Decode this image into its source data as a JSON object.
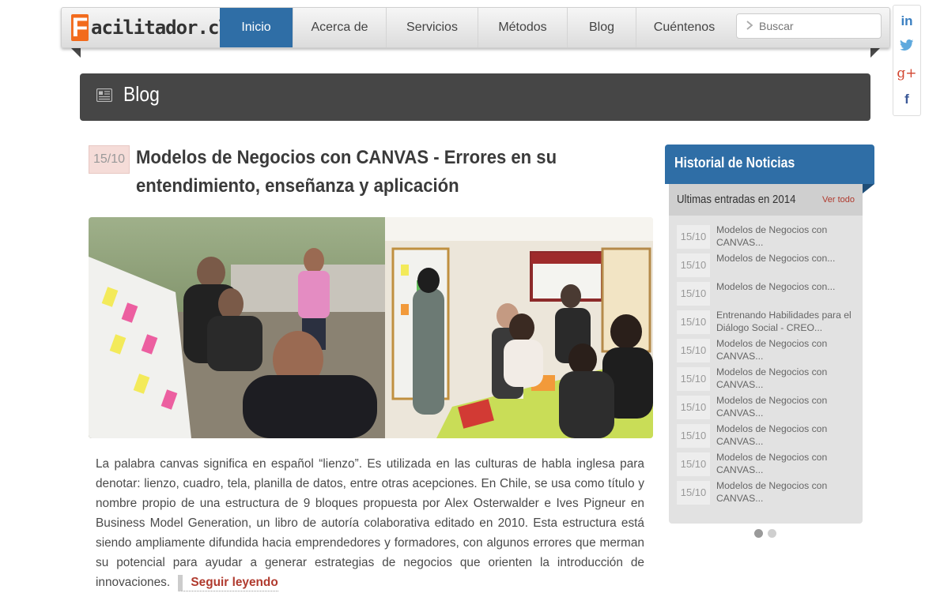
{
  "brand": {
    "letter": "F",
    "rest": "acilitador.cl"
  },
  "nav": {
    "items": [
      {
        "label": "Inicio",
        "active": true
      },
      {
        "label": "Acerca de",
        "active": false
      },
      {
        "label": "Servicios",
        "active": false
      },
      {
        "label": "Métodos",
        "active": false
      },
      {
        "label": "Blog",
        "active": false
      },
      {
        "label": "Cuéntenos",
        "active": false
      }
    ],
    "search_placeholder": "Buscar"
  },
  "social": {
    "linkedin": "in",
    "twitter": "twitter-bird-icon",
    "googleplus": "g+",
    "facebook": "f"
  },
  "page": {
    "section_title": "Blog"
  },
  "article": {
    "date": "15/10",
    "title": "Modelos de Negocios con CANVAS - Errores en su entendimiento, enseñanza y aplicación",
    "body": "La palabra canvas significa en español “lienzo”. Es utilizada en las culturas de habla inglesa para denotar: lienzo, cuadro, tela, planilla de datos, entre otras acepciones. En Chile, se usa como título y nombre propio de una estructura de 9 bloques propuesta por Alex Osterwalder e Ives Pigneur en Business Model Generation, un libro de autoría colaborativa editado en 2010. Esta estructura está siendo ampliamente difundida hacia emprendedores y formadores, con algunos errores que merman su potencial para ayudar a generar estrategias de negocios que orienten la introducción de innovaciones.",
    "read_more": "Seguir leyendo"
  },
  "sidebar": {
    "title": "Historial de Noticias",
    "subtitle": "Ultimas entradas en 2014",
    "see_all": "Ver todo",
    "entries": [
      {
        "date": "15/10",
        "text": "Modelos de Negocios con CANVAS..."
      },
      {
        "date": "15/10",
        "text": "Modelos de Negocios con..."
      },
      {
        "date": "15/10",
        "text": "Modelos de Negocios con..."
      },
      {
        "date": "15/10",
        "text": "Entrenando Habilidades para el Diálogo Social - CREO..."
      },
      {
        "date": "15/10",
        "text": "Modelos de Negocios con CANVAS..."
      },
      {
        "date": "15/10",
        "text": "Modelos de Negocios con CANVAS..."
      },
      {
        "date": "15/10",
        "text": "Modelos de Negocios con CANVAS..."
      },
      {
        "date": "15/10",
        "text": "Modelos de Negocios con CANVAS..."
      },
      {
        "date": "15/10",
        "text": "Modelos de Negocios con CANVAS..."
      },
      {
        "date": "15/10",
        "text": "Modelos de Negocios con CANVAS..."
      }
    ],
    "pager": {
      "pages": 2,
      "current": 1
    }
  },
  "colors": {
    "accent": "#2f6ea6",
    "brand_orange": "#f26b1d",
    "link_red": "#b03a2e",
    "header_dark": "#464646"
  }
}
